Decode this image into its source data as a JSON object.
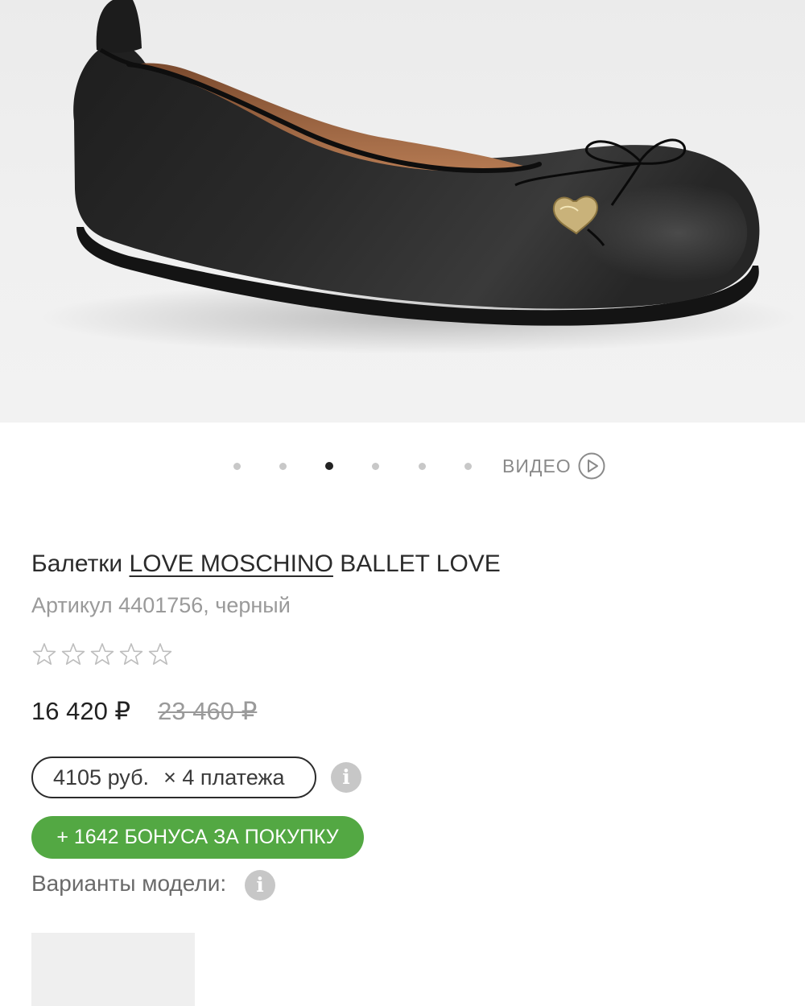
{
  "carousel": {
    "dot_count": 6,
    "active_index": 2,
    "video_label": "ВИДЕО"
  },
  "product": {
    "type_label": "Балетки",
    "brand": "LOVE MOSCHINO",
    "model": "BALLET LOVE",
    "article_line": "Артикул 4401756, черный",
    "rating": 0,
    "rating_max": 5
  },
  "price": {
    "current": "16 420 ₽",
    "old": "23 460 ₽"
  },
  "installment": {
    "amount": "4105 руб.",
    "times": "× 4 платежа"
  },
  "bonus": {
    "label": "+ 1642 БОНУСА ЗА ПОКУПКУ"
  },
  "variants": {
    "label": "Варианты модели:"
  },
  "colors": {
    "bonus_green": "#53a843",
    "info_gray": "#c7c7c7",
    "active_dot": "#222222",
    "inactive_dot": "#c8c8c8"
  },
  "icons": {
    "play": "play-circle-icon",
    "info": "info-icon",
    "star": "star-outline-icon"
  }
}
